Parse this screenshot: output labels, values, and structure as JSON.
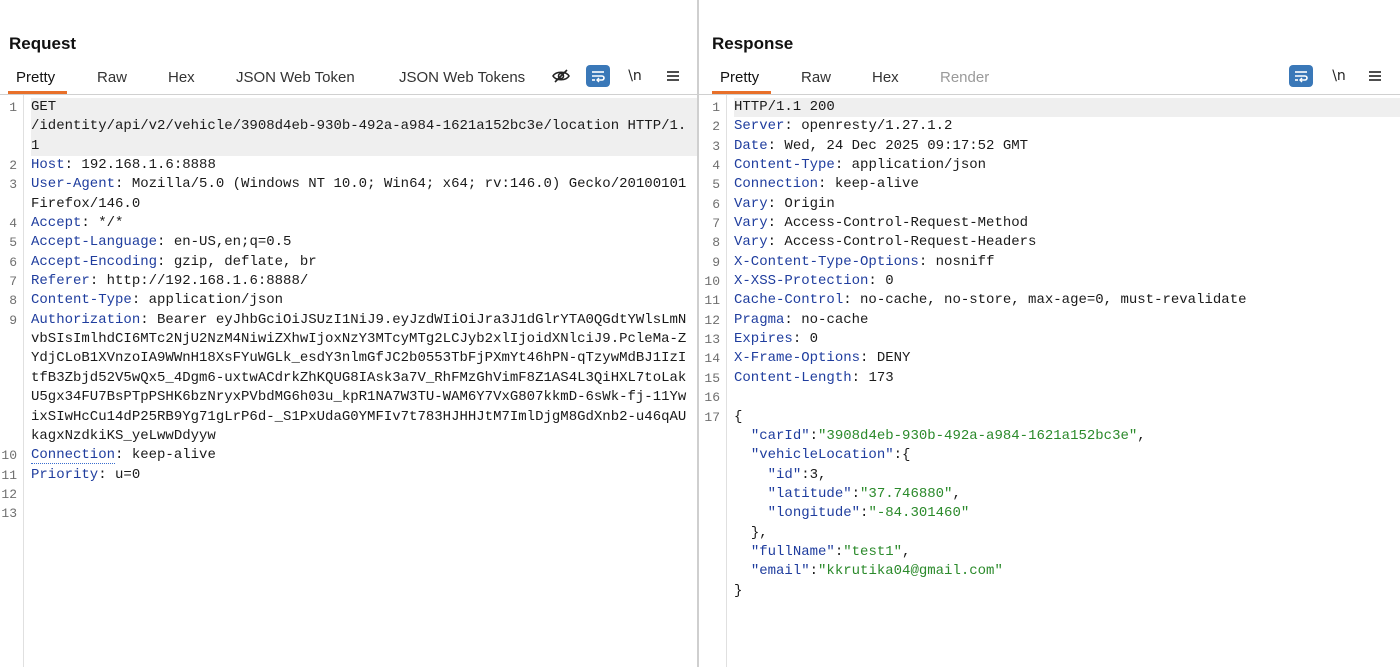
{
  "layout_buttons": [
    {
      "name": "split-columns-icon",
      "active": true
    },
    {
      "name": "split-rows-icon",
      "active": false
    },
    {
      "name": "single-pane-icon",
      "active": false
    }
  ],
  "request": {
    "title": "Request",
    "tabs": [
      {
        "label": "Pretty",
        "active": true
      },
      {
        "label": "Raw"
      },
      {
        "label": "Hex"
      },
      {
        "label": "JSON Web Token"
      },
      {
        "label": "JSON Web Tokens"
      }
    ],
    "toolbar": {
      "hide_icon": "eye-slash-icon",
      "wrap_icon": "wrap-lines-icon",
      "newline_label": "\\n",
      "menu_icon": "hamburger-menu-icon"
    },
    "lines": [
      {
        "n": "1",
        "method": "GET",
        "path": "/identity/api/v2/vehicle/3908d4eb-930b-492a-a984-1621a152bc3e/location HTTP/1.1"
      },
      {
        "n": "2",
        "key": "Host",
        "value": "192.168.1.6:8888"
      },
      {
        "n": "3",
        "key": "User-Agent",
        "value": "Mozilla/5.0 (Windows NT 10.0; Win64; x64; rv:146.0) Gecko/20100101 Firefox/146.0"
      },
      {
        "n": "4",
        "key": "Accept",
        "value": "*/*"
      },
      {
        "n": "5",
        "key": "Accept-Language",
        "value": "en-US,en;q=0.5"
      },
      {
        "n": "6",
        "key": "Accept-Encoding",
        "value": "gzip, deflate, br"
      },
      {
        "n": "7",
        "key": "Referer",
        "value": "http://192.168.1.6:8888/"
      },
      {
        "n": "8",
        "key": "Content-Type",
        "value": "application/json"
      },
      {
        "n": "9",
        "key": "Authorization",
        "value": "Bearer eyJhbGciOiJSUzI1NiJ9.eyJzdWIiOiJra3J1dGlrYTA0QGdtYWlsLmNvbSIsImlhdCI6MTc2NjU2NzM4NiwiZXhwIjoxNzY3MTcyMTg2LCJyb2xlIjoidXNlciJ9.PcleMa-ZYdjCLoB1XVnzoIA9WWnH18XsFYuWGLk_esdY3nlmGfJC2b0553TbFjPXmYt46hPN-qTzywMdBJ1IzItfB3Zbjd52V5wQx5_4Dgm6-uxtwACdrkZhKQUG8IAsk3a7V_RhFMzGhVimF8Z1AS4L3QiHXL7toLakU5gx34FU7BsPTpPSHK6bzNryxPVbdMG6h03u_kpR1NA7W3TU-WAM6Y7VxG807kkmD-6sWk-fj-11YwixSIwHcCu14dP25RB9Yg71gLrP6d-_S1PxUdaG0YMFIv7t783HJHHJtM7ImlDjgM8GdXnb2-u46qAUkagxNzdkiKS_yeLwwDdyyw"
      },
      {
        "n": "10",
        "key": "Connection",
        "value": "keep-alive"
      },
      {
        "n": "11",
        "key": "Priority",
        "value": "u=0"
      },
      {
        "n": "12"
      },
      {
        "n": "13"
      }
    ]
  },
  "response": {
    "title": "Response",
    "tabs": [
      {
        "label": "Pretty",
        "active": true
      },
      {
        "label": "Raw"
      },
      {
        "label": "Hex"
      },
      {
        "label": "Render",
        "disabled": true
      }
    ],
    "toolbar": {
      "wrap_icon": "wrap-lines-icon",
      "newline_label": "\\n",
      "menu_icon": "hamburger-menu-icon"
    },
    "lines": [
      {
        "n": "1",
        "text": "HTTP/1.1 200"
      },
      {
        "n": "2",
        "key": "Server",
        "value": "openresty/1.27.1.2"
      },
      {
        "n": "3",
        "key": "Date",
        "value": "Wed, 24 Dec 2025 09:17:52 GMT"
      },
      {
        "n": "4",
        "key": "Content-Type",
        "value": "application/json"
      },
      {
        "n": "5",
        "key": "Connection",
        "value": "keep-alive"
      },
      {
        "n": "6",
        "key": "Vary",
        "value": "Origin"
      },
      {
        "n": "7",
        "key": "Vary",
        "value": "Access-Control-Request-Method"
      },
      {
        "n": "8",
        "key": "Vary",
        "value": "Access-Control-Request-Headers"
      },
      {
        "n": "9",
        "key": "X-Content-Type-Options",
        "value": "nosniff"
      },
      {
        "n": "10",
        "key": "X-XSS-Protection",
        "value": "0"
      },
      {
        "n": "11",
        "key": "Cache-Control",
        "value": "no-cache, no-store, max-age=0, must-revalidate"
      },
      {
        "n": "12",
        "key": "Pragma",
        "value": "no-cache"
      },
      {
        "n": "13",
        "key": "Expires",
        "value": "0"
      },
      {
        "n": "14",
        "key": "X-Frame-Options",
        "value": "DENY"
      },
      {
        "n": "15",
        "key": "Content-Length",
        "value": "173"
      },
      {
        "n": "16"
      },
      {
        "n": "17",
        "text": "{"
      }
    ],
    "json": [
      {
        "indent": 1,
        "key": "\"carId\"",
        "value": "\"3908d4eb-930b-492a-a984-1621a152bc3e\"",
        "tail": ","
      },
      {
        "indent": 1,
        "key": "\"vehicleLocation\"",
        "open": "{"
      },
      {
        "indent": 2,
        "key": "\"id\"",
        "num": "3",
        "tail": ","
      },
      {
        "indent": 2,
        "key": "\"latitude\"",
        "value": "\"37.746880\"",
        "tail": ","
      },
      {
        "indent": 2,
        "key": "\"longitude\"",
        "value": "\"-84.301460\""
      },
      {
        "indent": 1,
        "text": "},"
      },
      {
        "indent": 1,
        "key": "\"fullName\"",
        "value": "\"test1\"",
        "tail": ","
      },
      {
        "indent": 1,
        "key": "\"email\"",
        "value": "\"kkrutika04@gmail.com\""
      },
      {
        "indent": 0,
        "text": "}"
      }
    ]
  }
}
